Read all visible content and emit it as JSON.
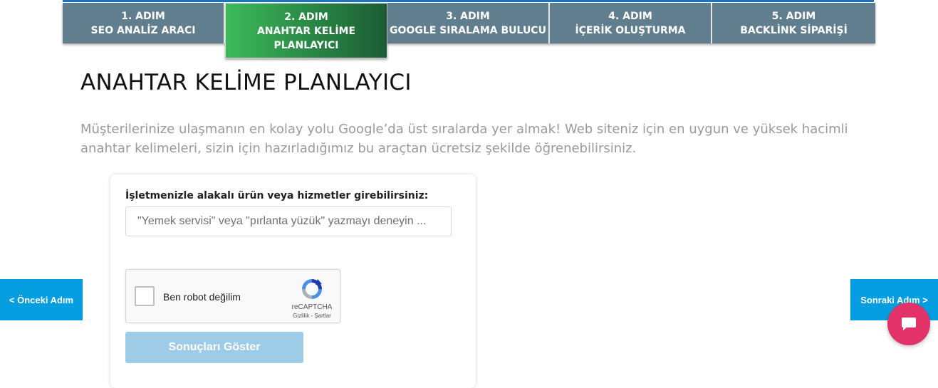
{
  "steps": [
    {
      "number": "1. ADIM",
      "label_lines": [
        "SEO ANALİZ ARACI"
      ]
    },
    {
      "number": "2. ADIM",
      "label_lines": [
        "ANAHTAR KELİME",
        "PLANLAYICI"
      ],
      "active": true
    },
    {
      "number": "3. ADIM",
      "label_lines": [
        "GOOGLE SIRALAMA BULUCU"
      ]
    },
    {
      "number": "4. ADIM",
      "label_lines": [
        "İÇERİK OLUŞTURMA"
      ]
    },
    {
      "number": "5. ADIM",
      "label_lines": [
        "BACKLİNK SİPARİŞİ"
      ]
    }
  ],
  "page": {
    "title": "ANAHTAR KELİME PLANLAYICI",
    "intro": "Müşterilerinize ulaşmanın en kolay yolu Google’da üst sıralarda yer almak! Web siteniz için en uygun ve yüksek hacimli anahtar kelimeleri, sizin için hazırladığımız bu araçtan ücretsiz şekilde öğrenebilirsiniz."
  },
  "form": {
    "label": "İşletmenizle alakalı ürün veya hizmetler girebilirsiniz:",
    "input_value": "",
    "placeholder": "\"Yemek servisi\" veya \"pırlanta yüzük\" yazmayı deneyin ...",
    "recaptcha": {
      "label": "Ben robot değilim",
      "brand": "reCAPTCHA",
      "links": "Gizlilik - Şartlar",
      "checked": false
    },
    "submit_label": "Sonuçları Göster"
  },
  "nav": {
    "prev": "< Önceki Adım",
    "next": "Sonraki Adım >"
  },
  "icons": {
    "chat": "chat-bubble-icon",
    "recaptcha": "recaptcha-logo-icon"
  },
  "colors": {
    "step_bg": "#617e8f",
    "step_active_from": "#3dba5a",
    "step_active_to": "#1b5c34",
    "nav_bg": "#049ee0",
    "submit_bg": "#9ecbe6",
    "chat_bg": "#e3326a",
    "top_accent": "#1e73be"
  }
}
